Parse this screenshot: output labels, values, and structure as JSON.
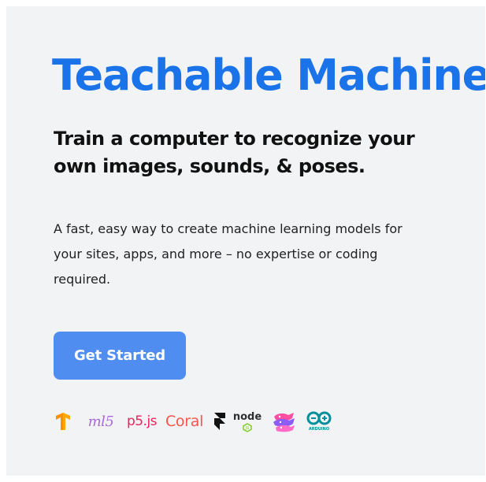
{
  "hero": {
    "title": "Teachable Machine",
    "subtitle_lines": [
      "Train a computer to recognize your",
      "own images, sounds, & poses."
    ],
    "description_lines": [
      "A fast, easy way to create machine learning models for",
      "your sites, apps, and more – no expertise or coding",
      "required."
    ],
    "cta_label": "Get Started"
  },
  "logos": [
    {
      "name": "tensorflow-icon"
    },
    {
      "name": "ml5-icon",
      "text": "ml5"
    },
    {
      "name": "p5js-icon",
      "text": "p5.js"
    },
    {
      "name": "coral-icon",
      "text": "Coral"
    },
    {
      "name": "framer-icon"
    },
    {
      "name": "nodejs-icon",
      "text": "node"
    },
    {
      "name": "glitch-icon"
    },
    {
      "name": "arduino-icon",
      "text": "ARDUINO"
    }
  ],
  "colors": {
    "accent": "#1a73e8",
    "button": "#4f8ef0",
    "background": "#f1f3f4"
  }
}
